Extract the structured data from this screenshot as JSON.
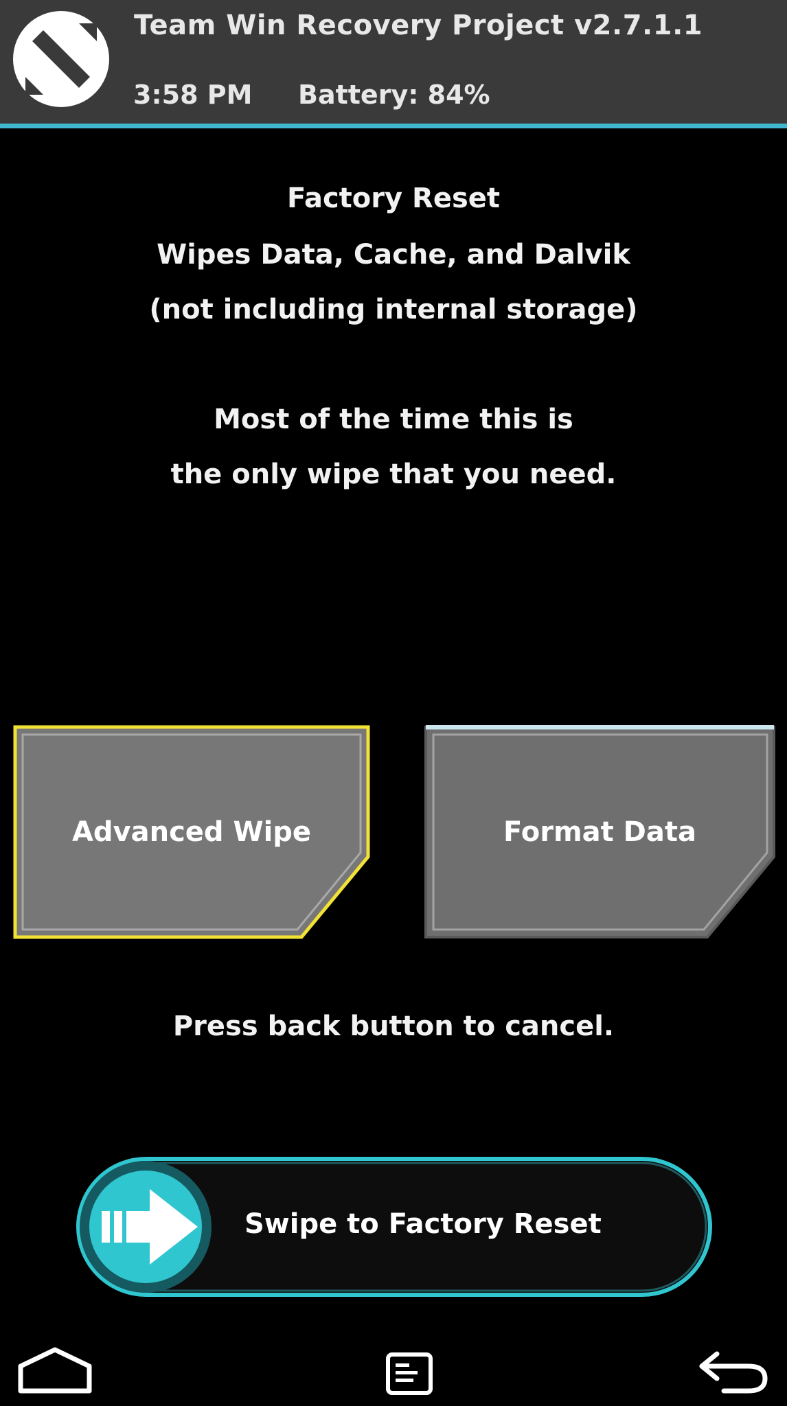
{
  "header": {
    "title": "Team Win Recovery Project  v2.7.1.1",
    "time": "3:58 PM",
    "battery": "Battery: 84%",
    "logo_icon": "twrp-logo-icon",
    "background_color": "#3a3a3a",
    "accent_color": "#3fb7cf"
  },
  "info": {
    "line1": "Factory Reset",
    "line2": "Wipes Data, Cache, and Dalvik",
    "line3": "(not including internal storage)",
    "line4": "Most of the time this is",
    "line5": "the only wipe that you need."
  },
  "buttons": {
    "advanced_wipe": "Advanced Wipe",
    "format_data": "Format Data",
    "selected_border_color": "#f2e235"
  },
  "cancel_text": "Press back button to cancel.",
  "slider": {
    "label": "Swipe to Factory Reset",
    "handle_icon": "arrow-right-icon",
    "color": "#2fc6cf"
  },
  "navbar": {
    "home_icon": "home-icon",
    "console_icon": "console-icon",
    "back_icon": "back-arrow-icon"
  }
}
